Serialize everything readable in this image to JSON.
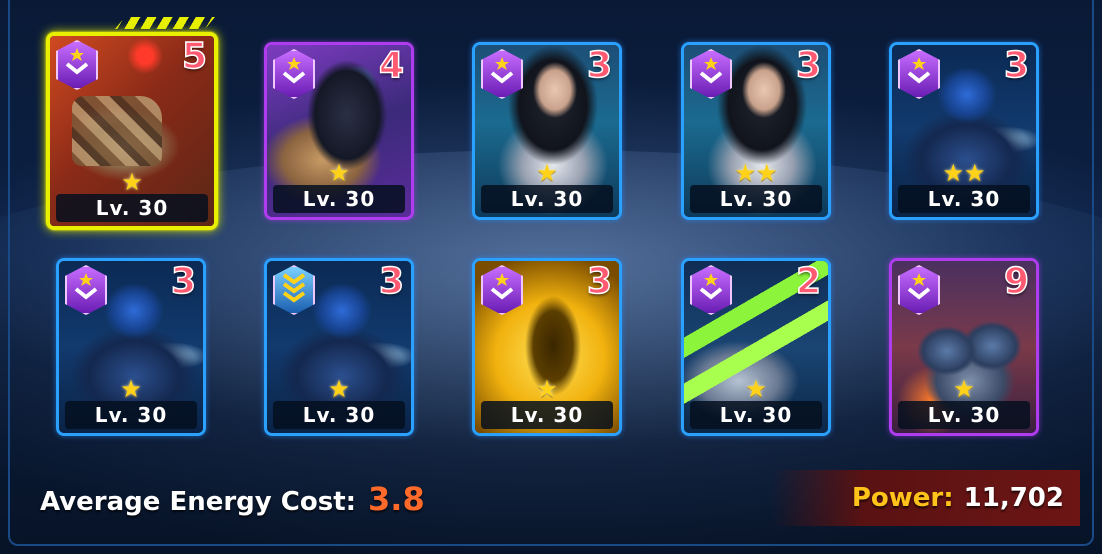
{
  "deck": {
    "cards": [
      {
        "art": "tank",
        "cost": "5",
        "level": "Lv. 30",
        "stars": "★",
        "rarity": "epic",
        "badge": "purple",
        "selected": true
      },
      {
        "art": "armor",
        "cost": "4",
        "level": "Lv. 30",
        "stars": "★",
        "rarity": "epic",
        "badge": "purple",
        "selected": false
      },
      {
        "art": "pilot",
        "cost": "3",
        "level": "Lv. 30",
        "stars": "★",
        "rarity": "rare",
        "badge": "purple",
        "selected": false
      },
      {
        "art": "pilot",
        "cost": "3",
        "level": "Lv. 30",
        "stars": "★★",
        "rarity": "rare",
        "badge": "purple",
        "selected": false
      },
      {
        "art": "bot",
        "cost": "3",
        "level": "Lv. 30",
        "stars": "★★",
        "rarity": "rare",
        "badge": "purple",
        "selected": false
      },
      {
        "art": "bot",
        "cost": "3",
        "level": "Lv. 30",
        "stars": "★",
        "rarity": "rare",
        "badge": "purple",
        "selected": false
      },
      {
        "art": "bot",
        "cost": "3",
        "level": "Lv. 30",
        "stars": "★",
        "rarity": "rare",
        "badge": "blue",
        "selected": false
      },
      {
        "art": "gold",
        "cost": "3",
        "level": "Lv. 30",
        "stars": "★",
        "rarity": "rare",
        "badge": "purple",
        "selected": false
      },
      {
        "art": "cannon",
        "cost": "2",
        "level": "Lv. 30",
        "stars": "★",
        "rarity": "rare",
        "badge": "purple",
        "selected": false
      },
      {
        "art": "mech",
        "cost": "9",
        "level": "Lv. 30",
        "stars": "★",
        "rarity": "epic",
        "badge": "purple",
        "selected": false
      }
    ]
  },
  "footer": {
    "avg_label": "Average Energy Cost:",
    "avg_value": "3.8",
    "power_label": "Power:",
    "power_value": "11,702"
  },
  "colors": {
    "rare_border": "#2aa0ff",
    "epic_border": "#b03cf0",
    "selected_border": "#e8f000",
    "cost_text": "#ff5a72",
    "avg_value": "#ff6a2a",
    "power_label": "#ffc31a"
  }
}
